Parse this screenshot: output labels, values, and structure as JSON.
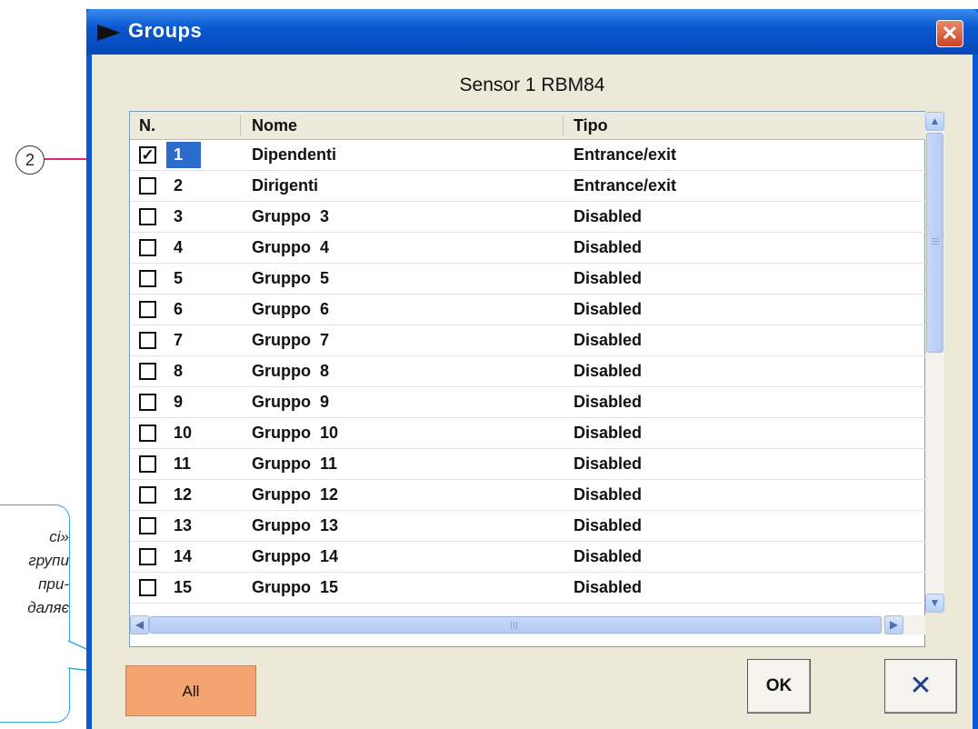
{
  "marker": {
    "label": "2"
  },
  "callout": {
    "lines": "сі»\nгрупи\n при-\nдаляє"
  },
  "window": {
    "title": "Groups",
    "close_label": "✕",
    "sensor_label": "Sensor 1 RBM84"
  },
  "list": {
    "columns": [
      "N.",
      "Nome",
      "Tipo"
    ],
    "rows": [
      {
        "checked": true,
        "n": "1",
        "nome": "Dipendenti",
        "tipo": "Entrance/exit",
        "selected": true
      },
      {
        "checked": false,
        "n": "2",
        "nome": "Dirigenti",
        "tipo": "Entrance/exit"
      },
      {
        "checked": false,
        "n": "3",
        "nome": "Gruppo  3",
        "tipo": "Disabled"
      },
      {
        "checked": false,
        "n": "4",
        "nome": "Gruppo  4",
        "tipo": "Disabled"
      },
      {
        "checked": false,
        "n": "5",
        "nome": "Gruppo  5",
        "tipo": "Disabled"
      },
      {
        "checked": false,
        "n": "6",
        "nome": "Gruppo  6",
        "tipo": "Disabled"
      },
      {
        "checked": false,
        "n": "7",
        "nome": "Gruppo  7",
        "tipo": "Disabled"
      },
      {
        "checked": false,
        "n": "8",
        "nome": "Gruppo  8",
        "tipo": "Disabled"
      },
      {
        "checked": false,
        "n": "9",
        "nome": "Gruppo  9",
        "tipo": "Disabled"
      },
      {
        "checked": false,
        "n": "10",
        "nome": "Gruppo  10",
        "tipo": "Disabled"
      },
      {
        "checked": false,
        "n": "11",
        "nome": "Gruppo  11",
        "tipo": "Disabled"
      },
      {
        "checked": false,
        "n": "12",
        "nome": "Gruppo  12",
        "tipo": "Disabled"
      },
      {
        "checked": false,
        "n": "13",
        "nome": "Gruppo  13",
        "tipo": "Disabled"
      },
      {
        "checked": false,
        "n": "14",
        "nome": "Gruppo  14",
        "tipo": "Disabled"
      },
      {
        "checked": false,
        "n": "15",
        "nome": "Gruppo  15",
        "tipo": "Disabled"
      }
    ]
  },
  "buttons": {
    "all_label": "All",
    "ok_label": "OK",
    "cancel_label": "✕"
  },
  "colors": {
    "titlebar": "#0a58d0",
    "selection": "#2a6bcb",
    "all_button": "#f4a470",
    "marker_line": "#e0257f",
    "callout_border": "#30a8d8"
  }
}
